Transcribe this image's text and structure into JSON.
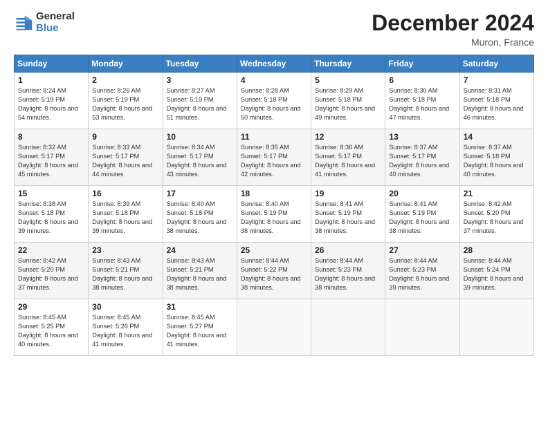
{
  "header": {
    "logo_line1": "General",
    "logo_line2": "Blue",
    "month_year": "December 2024",
    "location": "Muron, France"
  },
  "days_of_week": [
    "Sunday",
    "Monday",
    "Tuesday",
    "Wednesday",
    "Thursday",
    "Friday",
    "Saturday"
  ],
  "weeks": [
    [
      {
        "day": "1",
        "sunrise": "8:24 AM",
        "sunset": "5:19 PM",
        "daylight": "8 hours and 54 minutes."
      },
      {
        "day": "2",
        "sunrise": "8:26 AM",
        "sunset": "5:19 PM",
        "daylight": "8 hours and 53 minutes."
      },
      {
        "day": "3",
        "sunrise": "8:27 AM",
        "sunset": "5:19 PM",
        "daylight": "8 hours and 51 minutes."
      },
      {
        "day": "4",
        "sunrise": "8:28 AM",
        "sunset": "5:18 PM",
        "daylight": "8 hours and 50 minutes."
      },
      {
        "day": "5",
        "sunrise": "8:29 AM",
        "sunset": "5:18 PM",
        "daylight": "8 hours and 49 minutes."
      },
      {
        "day": "6",
        "sunrise": "8:30 AM",
        "sunset": "5:18 PM",
        "daylight": "8 hours and 47 minutes."
      },
      {
        "day": "7",
        "sunrise": "8:31 AM",
        "sunset": "5:18 PM",
        "daylight": "8 hours and 46 minutes."
      }
    ],
    [
      {
        "day": "8",
        "sunrise": "8:32 AM",
        "sunset": "5:17 PM",
        "daylight": "8 hours and 45 minutes."
      },
      {
        "day": "9",
        "sunrise": "8:33 AM",
        "sunset": "5:17 PM",
        "daylight": "8 hours and 44 minutes."
      },
      {
        "day": "10",
        "sunrise": "8:34 AM",
        "sunset": "5:17 PM",
        "daylight": "8 hours and 43 minutes."
      },
      {
        "day": "11",
        "sunrise": "8:35 AM",
        "sunset": "5:17 PM",
        "daylight": "8 hours and 42 minutes."
      },
      {
        "day": "12",
        "sunrise": "8:36 AM",
        "sunset": "5:17 PM",
        "daylight": "8 hours and 41 minutes."
      },
      {
        "day": "13",
        "sunrise": "8:37 AM",
        "sunset": "5:17 PM",
        "daylight": "8 hours and 40 minutes."
      },
      {
        "day": "14",
        "sunrise": "8:37 AM",
        "sunset": "5:18 PM",
        "daylight": "8 hours and 40 minutes."
      }
    ],
    [
      {
        "day": "15",
        "sunrise": "8:38 AM",
        "sunset": "5:18 PM",
        "daylight": "8 hours and 39 minutes."
      },
      {
        "day": "16",
        "sunrise": "8:39 AM",
        "sunset": "5:18 PM",
        "daylight": "8 hours and 39 minutes."
      },
      {
        "day": "17",
        "sunrise": "8:40 AM",
        "sunset": "5:18 PM",
        "daylight": "8 hours and 38 minutes."
      },
      {
        "day": "18",
        "sunrise": "8:40 AM",
        "sunset": "5:19 PM",
        "daylight": "8 hours and 38 minutes."
      },
      {
        "day": "19",
        "sunrise": "8:41 AM",
        "sunset": "5:19 PM",
        "daylight": "8 hours and 38 minutes."
      },
      {
        "day": "20",
        "sunrise": "8:41 AM",
        "sunset": "5:19 PM",
        "daylight": "8 hours and 38 minutes."
      },
      {
        "day": "21",
        "sunrise": "8:42 AM",
        "sunset": "5:20 PM",
        "daylight": "8 hours and 37 minutes."
      }
    ],
    [
      {
        "day": "22",
        "sunrise": "8:42 AM",
        "sunset": "5:20 PM",
        "daylight": "8 hours and 37 minutes."
      },
      {
        "day": "23",
        "sunrise": "8:43 AM",
        "sunset": "5:21 PM",
        "daylight": "8 hours and 38 minutes."
      },
      {
        "day": "24",
        "sunrise": "8:43 AM",
        "sunset": "5:21 PM",
        "daylight": "8 hours and 38 minutes."
      },
      {
        "day": "25",
        "sunrise": "8:44 AM",
        "sunset": "5:22 PM",
        "daylight": "8 hours and 38 minutes."
      },
      {
        "day": "26",
        "sunrise": "8:44 AM",
        "sunset": "5:23 PM",
        "daylight": "8 hours and 38 minutes."
      },
      {
        "day": "27",
        "sunrise": "8:44 AM",
        "sunset": "5:23 PM",
        "daylight": "8 hours and 39 minutes."
      },
      {
        "day": "28",
        "sunrise": "8:44 AM",
        "sunset": "5:24 PM",
        "daylight": "8 hours and 39 minutes."
      }
    ],
    [
      {
        "day": "29",
        "sunrise": "8:45 AM",
        "sunset": "5:25 PM",
        "daylight": "8 hours and 40 minutes."
      },
      {
        "day": "30",
        "sunrise": "8:45 AM",
        "sunset": "5:26 PM",
        "daylight": "8 hours and 41 minutes."
      },
      {
        "day": "31",
        "sunrise": "8:45 AM",
        "sunset": "5:27 PM",
        "daylight": "8 hours and 41 minutes."
      },
      null,
      null,
      null,
      null
    ]
  ]
}
